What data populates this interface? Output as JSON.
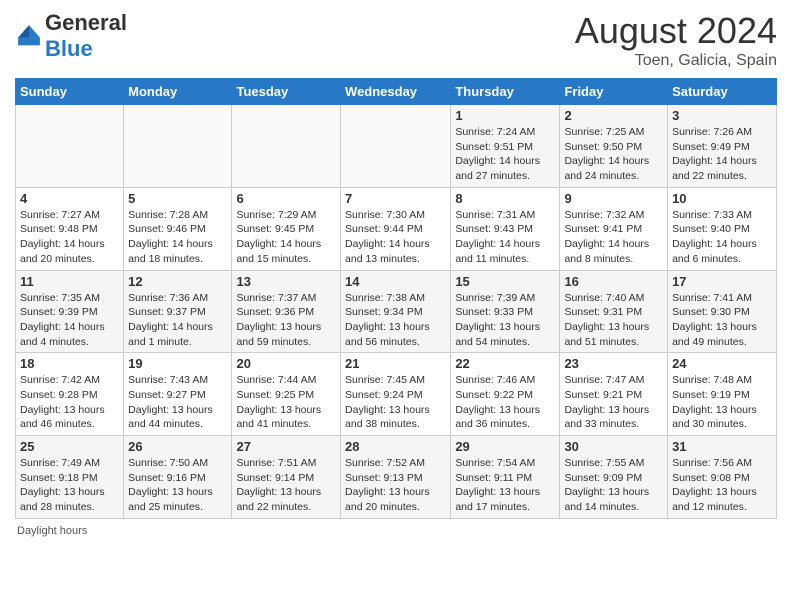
{
  "header": {
    "logo_general": "General",
    "logo_blue": "Blue",
    "month_title": "August 2024",
    "subtitle": "Toen, Galicia, Spain"
  },
  "days_of_week": [
    "Sunday",
    "Monday",
    "Tuesday",
    "Wednesday",
    "Thursday",
    "Friday",
    "Saturday"
  ],
  "weeks": [
    [
      {
        "day": "",
        "info": ""
      },
      {
        "day": "",
        "info": ""
      },
      {
        "day": "",
        "info": ""
      },
      {
        "day": "",
        "info": ""
      },
      {
        "day": "1",
        "info": "Sunrise: 7:24 AM\nSunset: 9:51 PM\nDaylight: 14 hours and 27 minutes."
      },
      {
        "day": "2",
        "info": "Sunrise: 7:25 AM\nSunset: 9:50 PM\nDaylight: 14 hours and 24 minutes."
      },
      {
        "day": "3",
        "info": "Sunrise: 7:26 AM\nSunset: 9:49 PM\nDaylight: 14 hours and 22 minutes."
      }
    ],
    [
      {
        "day": "4",
        "info": "Sunrise: 7:27 AM\nSunset: 9:48 PM\nDaylight: 14 hours and 20 minutes."
      },
      {
        "day": "5",
        "info": "Sunrise: 7:28 AM\nSunset: 9:46 PM\nDaylight: 14 hours and 18 minutes."
      },
      {
        "day": "6",
        "info": "Sunrise: 7:29 AM\nSunset: 9:45 PM\nDaylight: 14 hours and 15 minutes."
      },
      {
        "day": "7",
        "info": "Sunrise: 7:30 AM\nSunset: 9:44 PM\nDaylight: 14 hours and 13 minutes."
      },
      {
        "day": "8",
        "info": "Sunrise: 7:31 AM\nSunset: 9:43 PM\nDaylight: 14 hours and 11 minutes."
      },
      {
        "day": "9",
        "info": "Sunrise: 7:32 AM\nSunset: 9:41 PM\nDaylight: 14 hours and 8 minutes."
      },
      {
        "day": "10",
        "info": "Sunrise: 7:33 AM\nSunset: 9:40 PM\nDaylight: 14 hours and 6 minutes."
      }
    ],
    [
      {
        "day": "11",
        "info": "Sunrise: 7:35 AM\nSunset: 9:39 PM\nDaylight: 14 hours and 4 minutes."
      },
      {
        "day": "12",
        "info": "Sunrise: 7:36 AM\nSunset: 9:37 PM\nDaylight: 14 hours and 1 minute."
      },
      {
        "day": "13",
        "info": "Sunrise: 7:37 AM\nSunset: 9:36 PM\nDaylight: 13 hours and 59 minutes."
      },
      {
        "day": "14",
        "info": "Sunrise: 7:38 AM\nSunset: 9:34 PM\nDaylight: 13 hours and 56 minutes."
      },
      {
        "day": "15",
        "info": "Sunrise: 7:39 AM\nSunset: 9:33 PM\nDaylight: 13 hours and 54 minutes."
      },
      {
        "day": "16",
        "info": "Sunrise: 7:40 AM\nSunset: 9:31 PM\nDaylight: 13 hours and 51 minutes."
      },
      {
        "day": "17",
        "info": "Sunrise: 7:41 AM\nSunset: 9:30 PM\nDaylight: 13 hours and 49 minutes."
      }
    ],
    [
      {
        "day": "18",
        "info": "Sunrise: 7:42 AM\nSunset: 9:28 PM\nDaylight: 13 hours and 46 minutes."
      },
      {
        "day": "19",
        "info": "Sunrise: 7:43 AM\nSunset: 9:27 PM\nDaylight: 13 hours and 44 minutes."
      },
      {
        "day": "20",
        "info": "Sunrise: 7:44 AM\nSunset: 9:25 PM\nDaylight: 13 hours and 41 minutes."
      },
      {
        "day": "21",
        "info": "Sunrise: 7:45 AM\nSunset: 9:24 PM\nDaylight: 13 hours and 38 minutes."
      },
      {
        "day": "22",
        "info": "Sunrise: 7:46 AM\nSunset: 9:22 PM\nDaylight: 13 hours and 36 minutes."
      },
      {
        "day": "23",
        "info": "Sunrise: 7:47 AM\nSunset: 9:21 PM\nDaylight: 13 hours and 33 minutes."
      },
      {
        "day": "24",
        "info": "Sunrise: 7:48 AM\nSunset: 9:19 PM\nDaylight: 13 hours and 30 minutes."
      }
    ],
    [
      {
        "day": "25",
        "info": "Sunrise: 7:49 AM\nSunset: 9:18 PM\nDaylight: 13 hours and 28 minutes."
      },
      {
        "day": "26",
        "info": "Sunrise: 7:50 AM\nSunset: 9:16 PM\nDaylight: 13 hours and 25 minutes."
      },
      {
        "day": "27",
        "info": "Sunrise: 7:51 AM\nSunset: 9:14 PM\nDaylight: 13 hours and 22 minutes."
      },
      {
        "day": "28",
        "info": "Sunrise: 7:52 AM\nSunset: 9:13 PM\nDaylight: 13 hours and 20 minutes."
      },
      {
        "day": "29",
        "info": "Sunrise: 7:54 AM\nSunset: 9:11 PM\nDaylight: 13 hours and 17 minutes."
      },
      {
        "day": "30",
        "info": "Sunrise: 7:55 AM\nSunset: 9:09 PM\nDaylight: 13 hours and 14 minutes."
      },
      {
        "day": "31",
        "info": "Sunrise: 7:56 AM\nSunset: 9:08 PM\nDaylight: 13 hours and 12 minutes."
      }
    ]
  ],
  "footer": {
    "daylight_label": "Daylight hours"
  }
}
